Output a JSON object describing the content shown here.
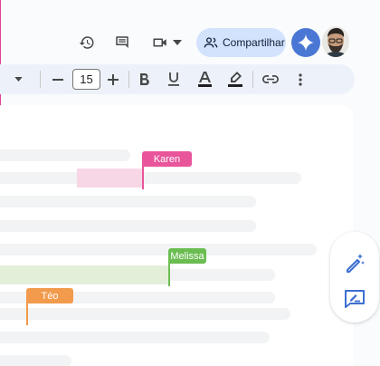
{
  "header": {
    "share_label": "Compartilhar",
    "icons": [
      "history-icon",
      "comments-icon",
      "video-icon",
      "chevron-down-icon",
      "share-people-icon",
      "gemini-icon"
    ]
  },
  "toolbar": {
    "font_size": "15",
    "icons": [
      "chevron-down-icon",
      "minus-icon",
      "plus-icon",
      "bold-icon",
      "underline-icon",
      "text-color-icon",
      "highlight-icon",
      "link-icon",
      "more-vert-icon"
    ]
  },
  "collaborators": [
    {
      "name": "Karen",
      "color": "#e8559b"
    },
    {
      "name": "Melissa",
      "color": "#6bbd52"
    },
    {
      "name": "Téo",
      "color": "#f29b4c"
    }
  ],
  "side_actions": [
    "edit-sparkle-icon",
    "feedback-icon"
  ],
  "colors": {
    "accent_share": "#d3e3fd",
    "gemini": "#4a77d4",
    "toolbar_bg": "#edf2fa",
    "doc_line": "#f1f3f4"
  }
}
